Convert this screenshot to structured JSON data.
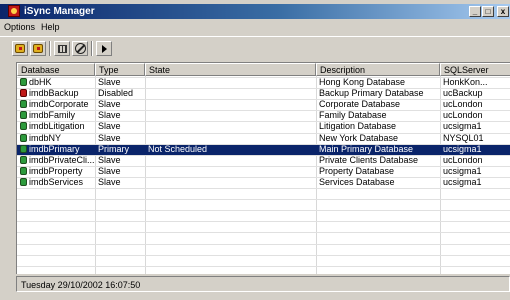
{
  "window": {
    "title": "iSync Manager",
    "controls": {
      "minimize": "_",
      "maximize": "□",
      "close": "x"
    }
  },
  "menu": [
    "Options",
    "Help"
  ],
  "toolbar": {
    "buttons": [
      "database-icon",
      "database-icon",
      "grid-icon",
      "stop-icon",
      "play-icon"
    ]
  },
  "table": {
    "columns": [
      "Database",
      "Type",
      "State",
      "Description",
      "SQLServer"
    ],
    "rows": [
      {
        "icon": "green",
        "database": "dbHK",
        "type": "Slave",
        "state": "",
        "description": "Hong Kong Database",
        "sqlserver": "HonkKon..."
      },
      {
        "icon": "red",
        "database": "imdbBackup",
        "type": "Disabled",
        "state": "",
        "description": "Backup Primary Database",
        "sqlserver": "ucBackup"
      },
      {
        "icon": "green",
        "database": "imdbCorporate",
        "type": "Slave",
        "state": "",
        "description": "Corporate Database",
        "sqlserver": "ucLondon"
      },
      {
        "icon": "green",
        "database": "imdbFamily",
        "type": "Slave",
        "state": "",
        "description": "Family Database",
        "sqlserver": "ucLondon"
      },
      {
        "icon": "green",
        "database": "imdbLitigation",
        "type": "Slave",
        "state": "",
        "description": "Litigation Database",
        "sqlserver": "ucsigma1"
      },
      {
        "icon": "green",
        "database": "imdbNY",
        "type": "Slave",
        "state": "",
        "description": "New York Database",
        "sqlserver": "NYSQL01"
      },
      {
        "icon": "green",
        "database": "imdbPrimary",
        "type": "Primary",
        "state": "Not Scheduled",
        "description": "Main Primary Database",
        "sqlserver": "ucsigma1",
        "selected": true
      },
      {
        "icon": "green",
        "database": "imdbPrivateCli...",
        "type": "Slave",
        "state": "",
        "description": "Private Clients Database",
        "sqlserver": "ucLondon"
      },
      {
        "icon": "green",
        "database": "imdbProperty",
        "type": "Slave",
        "state": "",
        "description": "Property Database",
        "sqlserver": "ucsigma1"
      },
      {
        "icon": "green",
        "database": "imdbServices",
        "type": "Slave",
        "state": "",
        "description": "Services Database",
        "sqlserver": "ucsigma1"
      }
    ]
  },
  "status": {
    "text": "Tuesday 29/10/2002 16:07:50"
  },
  "colors": {
    "selection": "#0a246a",
    "title_start": "#0a246a",
    "face": "#d4d0c8"
  }
}
